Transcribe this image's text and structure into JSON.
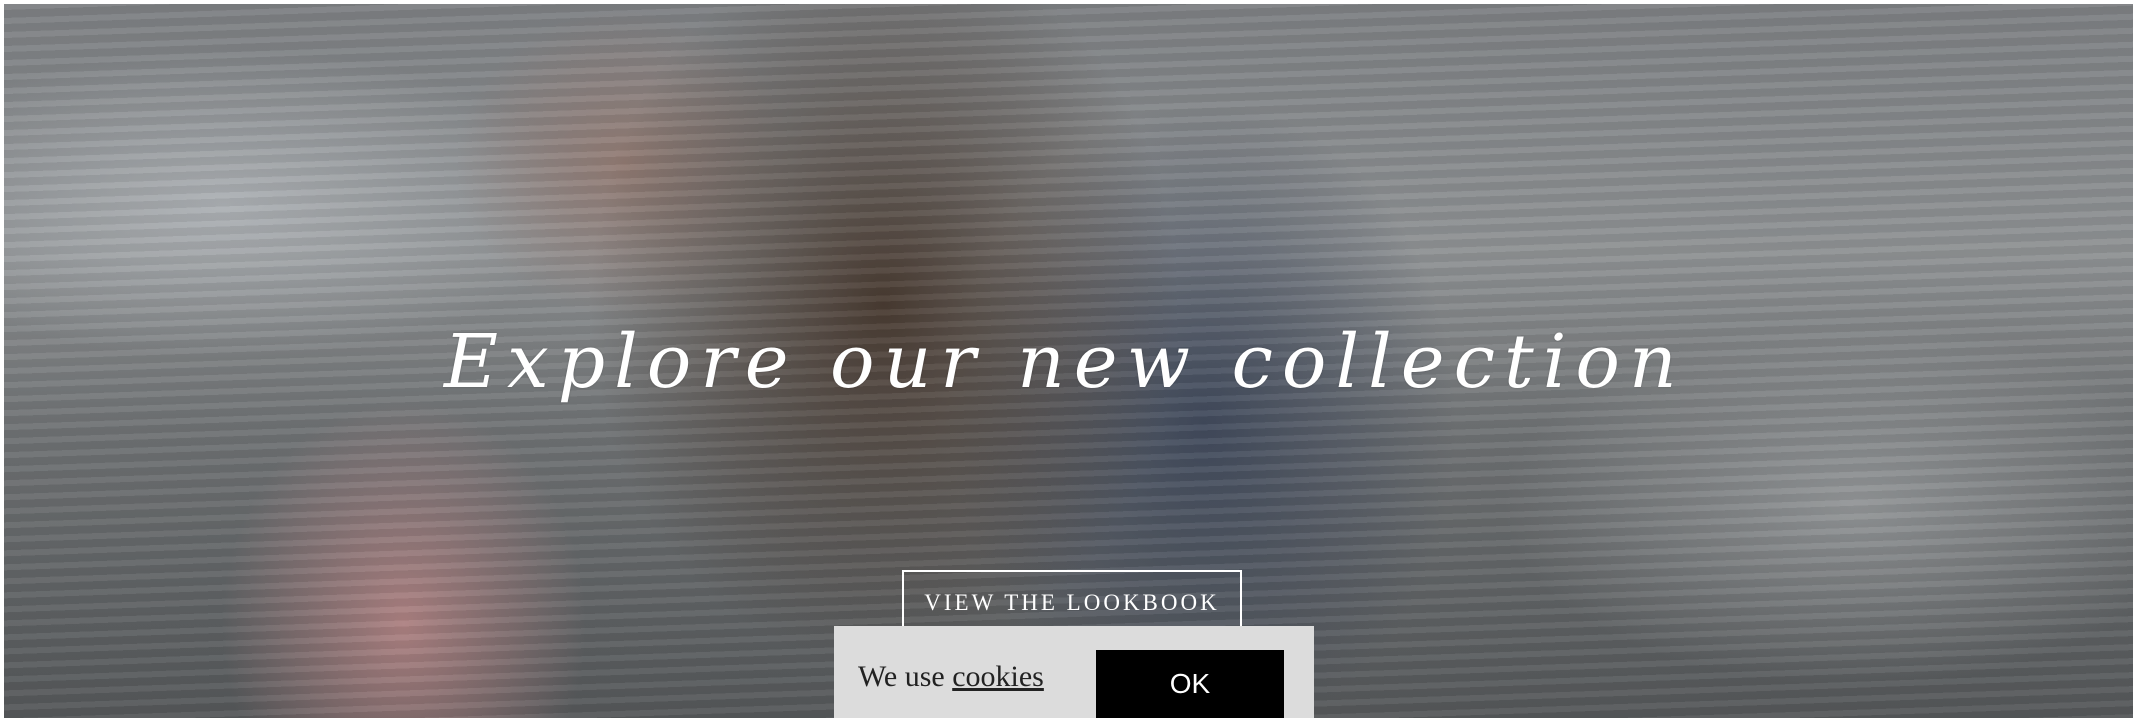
{
  "hero": {
    "headline": "Explore our new collection",
    "lookbook_button": "VIEW THE LOOKBOOK"
  },
  "cookie_notice": {
    "text_prefix": "We use ",
    "link_text": "cookies",
    "ok_button": "OK"
  },
  "colors": {
    "cookie_background": "#dcdcdc",
    "ok_button_background": "#000000",
    "text_on_image": "#ffffff"
  }
}
